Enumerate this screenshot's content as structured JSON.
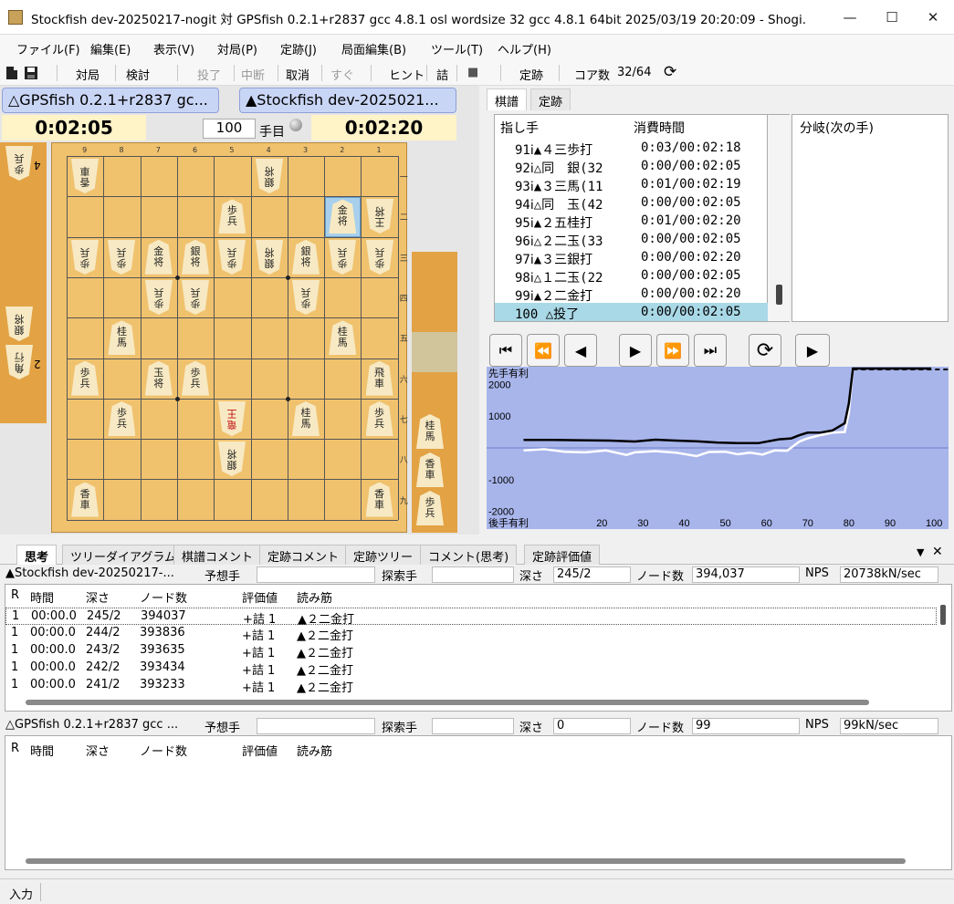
{
  "window": {
    "title": "Stockfish dev-20250217-nogit 対 GPSfish 0.2.1+r2837 gcc 4.8.1 osl wordsize 32 gcc 4.8.1 64bit 2025/03/19 20:20:09 - Shogi...",
    "min_glyph": "—",
    "max_glyph": "☐",
    "close_glyph": "✕"
  },
  "menu": [
    "ファイル(F)",
    "編集(E)",
    "表示(V)",
    "対局(P)",
    "定跡(J)",
    "局面編集(B)",
    "ツール(T)",
    "ヘルプ(H)"
  ],
  "toolbar": {
    "taikyoku": "対局",
    "kento": "検討",
    "toryo": "投了",
    "chudan": "中断",
    "torikeshi": "取消",
    "sugu": "すぐ",
    "hint": "ヒント",
    "tsume": "詰",
    "stop": "■",
    "joseki": "定跡",
    "core_label": "コア数",
    "core_value": "32/64",
    "refresh": "⟳"
  },
  "players": {
    "gote_name": "△GPSfish 0.2.1+r2837 gc...",
    "sente_name": "▲Stockfish dev-2025021...",
    "gote_time": "0:02:05",
    "sente_time": "0:02:20",
    "move_number": "100",
    "move_suffix": "手目"
  },
  "board": {
    "col_labels": [
      "9",
      "8",
      "7",
      "6",
      "5",
      "4",
      "3",
      "2",
      "1"
    ],
    "row_labels": [
      "一",
      "二",
      "三",
      "四",
      "五",
      "六",
      "七",
      "八",
      "九"
    ],
    "pieces": [
      {
        "col": 0,
        "row": 0,
        "t1": "香",
        "t2": "車",
        "inv": true
      },
      {
        "col": 5,
        "row": 0,
        "t1": "銀",
        "t2": "将",
        "inv": true
      },
      {
        "col": 4,
        "row": 1,
        "t1": "歩",
        "t2": "兵",
        "inv": false
      },
      {
        "col": 7,
        "row": 1,
        "t1": "金",
        "t2": "将",
        "inv": false
      },
      {
        "col": 8,
        "row": 1,
        "t1": "王",
        "t2": "将",
        "inv": true
      },
      {
        "col": 0,
        "row": 2,
        "t1": "歩",
        "t2": "兵",
        "inv": true
      },
      {
        "col": 1,
        "row": 2,
        "t1": "歩",
        "t2": "兵",
        "inv": true
      },
      {
        "col": 2,
        "row": 2,
        "t1": "金",
        "t2": "将",
        "inv": false
      },
      {
        "col": 3,
        "row": 2,
        "t1": "銀",
        "t2": "将",
        "inv": false
      },
      {
        "col": 4,
        "row": 2,
        "t1": "歩",
        "t2": "兵",
        "inv": true
      },
      {
        "col": 5,
        "row": 2,
        "t1": "銀",
        "t2": "将",
        "inv": true
      },
      {
        "col": 6,
        "row": 2,
        "t1": "銀",
        "t2": "将",
        "inv": false
      },
      {
        "col": 7,
        "row": 2,
        "t1": "歩",
        "t2": "兵",
        "inv": true
      },
      {
        "col": 8,
        "row": 2,
        "t1": "歩",
        "t2": "兵",
        "inv": true
      },
      {
        "col": 2,
        "row": 3,
        "t1": "歩",
        "t2": "兵",
        "inv": true
      },
      {
        "col": 3,
        "row": 3,
        "t1": "歩",
        "t2": "兵",
        "inv": true
      },
      {
        "col": 6,
        "row": 3,
        "t1": "歩",
        "t2": "兵",
        "inv": true
      },
      {
        "col": 1,
        "row": 4,
        "t1": "桂",
        "t2": "馬",
        "inv": false
      },
      {
        "col": 7,
        "row": 4,
        "t1": "桂",
        "t2": "馬",
        "inv": false
      },
      {
        "col": 0,
        "row": 5,
        "t1": "歩",
        "t2": "兵",
        "inv": false
      },
      {
        "col": 2,
        "row": 5,
        "t1": "玉",
        "t2": "将",
        "inv": false
      },
      {
        "col": 3,
        "row": 5,
        "t1": "歩",
        "t2": "兵",
        "inv": false
      },
      {
        "col": 8,
        "row": 5,
        "t1": "飛",
        "t2": "車",
        "inv": false
      },
      {
        "col": 1,
        "row": 6,
        "t1": "歩",
        "t2": "兵",
        "inv": false
      },
      {
        "col": 4,
        "row": 6,
        "t1": "竜",
        "t2": "王",
        "inv": true,
        "red": true
      },
      {
        "col": 6,
        "row": 6,
        "t1": "桂",
        "t2": "馬",
        "inv": false
      },
      {
        "col": 8,
        "row": 6,
        "t1": "歩",
        "t2": "兵",
        "inv": false
      },
      {
        "col": 4,
        "row": 7,
        "t1": "銀",
        "t2": "将",
        "inv": true
      },
      {
        "col": 0,
        "row": 8,
        "t1": "香",
        "t2": "車",
        "inv": false
      },
      {
        "col": 8,
        "row": 8,
        "t1": "香",
        "t2": "車",
        "inv": false
      }
    ],
    "highlight": {
      "col": 7,
      "row": 1
    }
  },
  "gote_hand": [
    {
      "t1": "歩",
      "t2": "兵",
      "count": "4"
    },
    {
      "t1": "銀",
      "t2": "将",
      "count": ""
    },
    {
      "t1": "角",
      "t2": "行",
      "count": "2"
    }
  ],
  "sente_hand": [
    {
      "t1": "桂",
      "t2": "馬"
    },
    {
      "t1": "香",
      "t2": "車"
    },
    {
      "t1": "歩",
      "t2": "兵"
    }
  ],
  "right_tabs": [
    "棋譜",
    "定跡"
  ],
  "kifu": {
    "col_move": "指し手",
    "col_time": "消費時間",
    "rows": [
      {
        "move": "91ⅰ▲４三歩打",
        "time": "0:03/00:02:18"
      },
      {
        "move": "92ⅰ△同　銀(32",
        "time": "0:00/00:02:05"
      },
      {
        "move": "93ⅰ▲３三馬(11",
        "time": "0:01/00:02:19"
      },
      {
        "move": "94ⅰ△同　玉(42",
        "time": "0:00/00:02:05"
      },
      {
        "move": "95ⅰ▲２五桂打",
        "time": "0:01/00:02:20"
      },
      {
        "move": "96ⅰ△２二玉(33",
        "time": "0:00/00:02:05"
      },
      {
        "move": "97ⅰ▲３三銀打",
        "time": "0:00/00:02:20"
      },
      {
        "move": "98ⅰ△１二玉(22",
        "time": "0:00/00:02:05"
      },
      {
        "move": "99ⅰ▲２二金打",
        "time": "0:00/00:02:20"
      },
      {
        "move": "100 △投了",
        "time": "0:00/00:02:05"
      }
    ],
    "branch_header": "分岐(次の手)"
  },
  "nav_buttons": [
    "⏮",
    "⏪",
    "◀",
    "▶",
    "⏩",
    "⏭",
    "⟳",
    "▶"
  ],
  "graph": {
    "top_label": "先手有利",
    "bottom_label": "後手有利",
    "ylim": [
      -2500,
      2500
    ],
    "xlim": [
      0,
      100
    ],
    "y_ticks": [
      "2000",
      "1000",
      "-1000",
      "-2000"
    ],
    "y_tick_values": [
      2000,
      1000,
      -1000,
      -2000
    ],
    "x_ticks": [
      "20",
      "30",
      "40",
      "50",
      "60",
      "70",
      "80",
      "90",
      "100"
    ],
    "x_tick_values": [
      20,
      30,
      40,
      50,
      60,
      70,
      80,
      90,
      100
    ],
    "series_sente": [
      [
        1,
        250
      ],
      [
        8,
        250
      ],
      [
        15,
        240
      ],
      [
        22,
        230
      ],
      [
        28,
        200
      ],
      [
        33,
        260
      ],
      [
        38,
        230
      ],
      [
        43,
        210
      ],
      [
        48,
        170
      ],
      [
        53,
        150
      ],
      [
        58,
        150
      ],
      [
        63,
        270
      ],
      [
        66,
        300
      ],
      [
        68,
        400
      ],
      [
        70,
        480
      ],
      [
        73,
        480
      ],
      [
        76,
        550
      ],
      [
        79,
        780
      ],
      [
        80,
        1400
      ],
      [
        81,
        2500
      ],
      [
        100,
        2500
      ]
    ],
    "series_gote": [
      [
        1,
        -80
      ],
      [
        6,
        -40
      ],
      [
        11,
        -120
      ],
      [
        16,
        -140
      ],
      [
        21,
        -80
      ],
      [
        26,
        -220
      ],
      [
        28,
        -140
      ],
      [
        33,
        -100
      ],
      [
        38,
        -150
      ],
      [
        43,
        -260
      ],
      [
        46,
        -130
      ],
      [
        50,
        -120
      ],
      [
        53,
        -200
      ],
      [
        56,
        -150
      ],
      [
        59,
        -210
      ],
      [
        62,
        -80
      ],
      [
        65,
        -90
      ],
      [
        68,
        200
      ],
      [
        70,
        300
      ],
      [
        73,
        400
      ],
      [
        76,
        480
      ],
      [
        79,
        500
      ],
      [
        80,
        1100
      ],
      [
        81,
        2500
      ]
    ],
    "sente_color": "#000000",
    "gote_color": "#ffffff"
  },
  "bottom_tabs": [
    "思考",
    "ツリーダイアグラム",
    "棋譜コメント",
    "定跡コメント",
    "定跡ツリー",
    "コメント(思考)",
    "定跡評価値"
  ],
  "bottom_controls": {
    "dropdown": "▼",
    "close": "✕"
  },
  "think1": {
    "engine": "▲Stockfish dev-20250217-...",
    "yoso_label": "予想手",
    "yoso_value": "",
    "tansaku_label": "探索手",
    "tansaku_value": "",
    "depth_label": "深さ",
    "depth_value": "245/2",
    "nodes_label": "ノード数",
    "nodes_value": "394,037",
    "nps_label": "NPS",
    "nps_value": "20738kN/sec",
    "headers": [
      "R",
      "時間",
      "深さ",
      "ノード数",
      "評価値",
      "読み筋"
    ],
    "rows": [
      [
        "1",
        "00:00.0",
        "245/2",
        "394037",
        "+詰 1",
        "▲２二金打"
      ],
      [
        "1",
        "00:00.0",
        "244/2",
        "393836",
        "+詰 1",
        "▲２二金打"
      ],
      [
        "1",
        "00:00.0",
        "243/2",
        "393635",
        "+詰 1",
        "▲２二金打"
      ],
      [
        "1",
        "00:00.0",
        "242/2",
        "393434",
        "+詰 1",
        "▲２二金打"
      ],
      [
        "1",
        "00:00.0",
        "241/2",
        "393233",
        "+詰 1",
        "▲２二金打"
      ]
    ]
  },
  "think2": {
    "engine": "△GPSfish 0.2.1+r2837 gcc ...",
    "yoso_label": "予想手",
    "yoso_value": "",
    "tansaku_label": "探索手",
    "tansaku_value": "",
    "depth_label": "深さ",
    "depth_value": "0",
    "nodes_label": "ノード数",
    "nodes_value": "99",
    "nps_label": "NPS",
    "nps_value": "99kN/sec",
    "headers": [
      "R",
      "時間",
      "深さ",
      "ノード数",
      "評価値",
      "読み筋"
    ]
  },
  "status": {
    "input_label": "入力"
  }
}
